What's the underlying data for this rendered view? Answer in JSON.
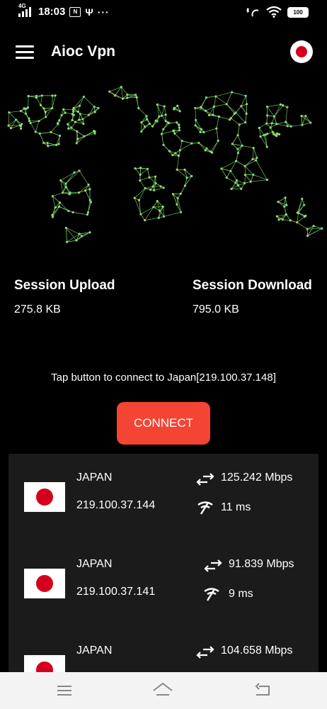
{
  "status_bar": {
    "network": "4G",
    "time": "18:03",
    "badge": "N",
    "usb": "Ψ",
    "more": "···",
    "battery": "100"
  },
  "app_bar": {
    "title": "Aioc Vpn",
    "selected_flag": "japan-flag"
  },
  "session": {
    "upload_label": "Session Upload",
    "upload_value": "275.8 KB",
    "download_label": "Session Download",
    "download_value": "795.0 KB"
  },
  "connect_hint": "Tap button to connect to Japan[219.100.37.148]",
  "connect_button": "CONNECT",
  "servers": [
    {
      "country": "JAPAN",
      "ip": "219.100.37.144",
      "speed": "125.242 Mbps",
      "ping": "11 ms"
    },
    {
      "country": "JAPAN",
      "ip": "219.100.37.141",
      "speed": "91.839 Mbps",
      "ping": "9 ms"
    },
    {
      "country": "JAPAN",
      "ip": "",
      "speed": "104.658 Mbps",
      "ping": ""
    }
  ],
  "icons": {
    "menu": "menu-icon",
    "speed": "speed-arrows-icon",
    "ping": "ping-signal-icon",
    "nav_recent": "recents-icon",
    "nav_home": "home-icon",
    "nav_back": "back-icon"
  },
  "colors": {
    "connect": "#f44434",
    "list_background": "#1b1b1b",
    "map_west": "#c8d84a",
    "map_east": "#3fe0b0"
  }
}
